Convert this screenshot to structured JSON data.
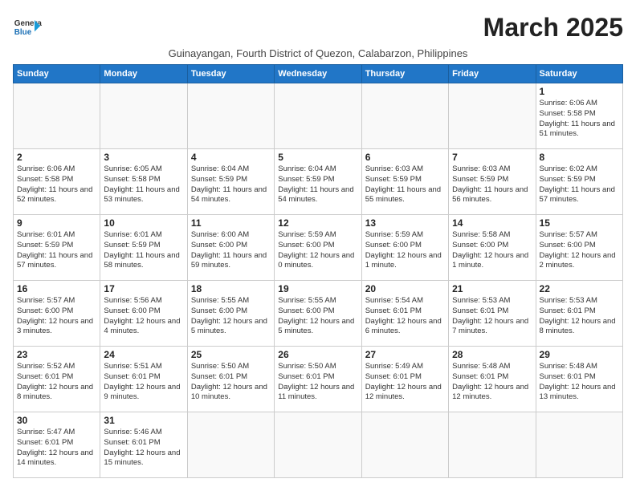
{
  "header": {
    "logo_line1": "General",
    "logo_line2": "Blue",
    "month_title": "March 2025",
    "subtitle": "Guinayangan, Fourth District of Quezon, Calabarzon, Philippines"
  },
  "days_of_week": [
    "Sunday",
    "Monday",
    "Tuesday",
    "Wednesday",
    "Thursday",
    "Friday",
    "Saturday"
  ],
  "weeks": [
    [
      {
        "day": "",
        "info": ""
      },
      {
        "day": "",
        "info": ""
      },
      {
        "day": "",
        "info": ""
      },
      {
        "day": "",
        "info": ""
      },
      {
        "day": "",
        "info": ""
      },
      {
        "day": "",
        "info": ""
      },
      {
        "day": "1",
        "info": "Sunrise: 6:06 AM\nSunset: 5:58 PM\nDaylight: 11 hours and 51 minutes."
      }
    ],
    [
      {
        "day": "2",
        "info": "Sunrise: 6:06 AM\nSunset: 5:58 PM\nDaylight: 11 hours and 52 minutes."
      },
      {
        "day": "3",
        "info": "Sunrise: 6:05 AM\nSunset: 5:58 PM\nDaylight: 11 hours and 53 minutes."
      },
      {
        "day": "4",
        "info": "Sunrise: 6:04 AM\nSunset: 5:59 PM\nDaylight: 11 hours and 54 minutes."
      },
      {
        "day": "5",
        "info": "Sunrise: 6:04 AM\nSunset: 5:59 PM\nDaylight: 11 hours and 54 minutes."
      },
      {
        "day": "6",
        "info": "Sunrise: 6:03 AM\nSunset: 5:59 PM\nDaylight: 11 hours and 55 minutes."
      },
      {
        "day": "7",
        "info": "Sunrise: 6:03 AM\nSunset: 5:59 PM\nDaylight: 11 hours and 56 minutes."
      },
      {
        "day": "8",
        "info": "Sunrise: 6:02 AM\nSunset: 5:59 PM\nDaylight: 11 hours and 57 minutes."
      }
    ],
    [
      {
        "day": "9",
        "info": "Sunrise: 6:01 AM\nSunset: 5:59 PM\nDaylight: 11 hours and 57 minutes."
      },
      {
        "day": "10",
        "info": "Sunrise: 6:01 AM\nSunset: 5:59 PM\nDaylight: 11 hours and 58 minutes."
      },
      {
        "day": "11",
        "info": "Sunrise: 6:00 AM\nSunset: 6:00 PM\nDaylight: 11 hours and 59 minutes."
      },
      {
        "day": "12",
        "info": "Sunrise: 5:59 AM\nSunset: 6:00 PM\nDaylight: 12 hours and 0 minutes."
      },
      {
        "day": "13",
        "info": "Sunrise: 5:59 AM\nSunset: 6:00 PM\nDaylight: 12 hours and 1 minute."
      },
      {
        "day": "14",
        "info": "Sunrise: 5:58 AM\nSunset: 6:00 PM\nDaylight: 12 hours and 1 minute."
      },
      {
        "day": "15",
        "info": "Sunrise: 5:57 AM\nSunset: 6:00 PM\nDaylight: 12 hours and 2 minutes."
      }
    ],
    [
      {
        "day": "16",
        "info": "Sunrise: 5:57 AM\nSunset: 6:00 PM\nDaylight: 12 hours and 3 minutes."
      },
      {
        "day": "17",
        "info": "Sunrise: 5:56 AM\nSunset: 6:00 PM\nDaylight: 12 hours and 4 minutes."
      },
      {
        "day": "18",
        "info": "Sunrise: 5:55 AM\nSunset: 6:00 PM\nDaylight: 12 hours and 5 minutes."
      },
      {
        "day": "19",
        "info": "Sunrise: 5:55 AM\nSunset: 6:00 PM\nDaylight: 12 hours and 5 minutes."
      },
      {
        "day": "20",
        "info": "Sunrise: 5:54 AM\nSunset: 6:01 PM\nDaylight: 12 hours and 6 minutes."
      },
      {
        "day": "21",
        "info": "Sunrise: 5:53 AM\nSunset: 6:01 PM\nDaylight: 12 hours and 7 minutes."
      },
      {
        "day": "22",
        "info": "Sunrise: 5:53 AM\nSunset: 6:01 PM\nDaylight: 12 hours and 8 minutes."
      }
    ],
    [
      {
        "day": "23",
        "info": "Sunrise: 5:52 AM\nSunset: 6:01 PM\nDaylight: 12 hours and 8 minutes."
      },
      {
        "day": "24",
        "info": "Sunrise: 5:51 AM\nSunset: 6:01 PM\nDaylight: 12 hours and 9 minutes."
      },
      {
        "day": "25",
        "info": "Sunrise: 5:50 AM\nSunset: 6:01 PM\nDaylight: 12 hours and 10 minutes."
      },
      {
        "day": "26",
        "info": "Sunrise: 5:50 AM\nSunset: 6:01 PM\nDaylight: 12 hours and 11 minutes."
      },
      {
        "day": "27",
        "info": "Sunrise: 5:49 AM\nSunset: 6:01 PM\nDaylight: 12 hours and 12 minutes."
      },
      {
        "day": "28",
        "info": "Sunrise: 5:48 AM\nSunset: 6:01 PM\nDaylight: 12 hours and 12 minutes."
      },
      {
        "day": "29",
        "info": "Sunrise: 5:48 AM\nSunset: 6:01 PM\nDaylight: 12 hours and 13 minutes."
      }
    ],
    [
      {
        "day": "30",
        "info": "Sunrise: 5:47 AM\nSunset: 6:01 PM\nDaylight: 12 hours and 14 minutes."
      },
      {
        "day": "31",
        "info": "Sunrise: 5:46 AM\nSunset: 6:01 PM\nDaylight: 12 hours and 15 minutes."
      },
      {
        "day": "",
        "info": ""
      },
      {
        "day": "",
        "info": ""
      },
      {
        "day": "",
        "info": ""
      },
      {
        "day": "",
        "info": ""
      },
      {
        "day": "",
        "info": ""
      }
    ]
  ]
}
